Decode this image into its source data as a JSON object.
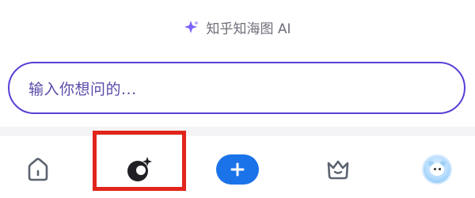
{
  "header": {
    "ai_label": "知乎知海图 AI",
    "icon": "sparkle-icon",
    "icon_color": "#7b61ff"
  },
  "search": {
    "placeholder": "输入你想问的..."
  },
  "tabbar": {
    "items": [
      {
        "name": "home",
        "icon": "home-icon"
      },
      {
        "name": "ai-night",
        "icon": "moon-sparkle-icon",
        "selected": true
      },
      {
        "name": "create",
        "icon": "plus-icon",
        "color": "#1a73e8"
      },
      {
        "name": "vip",
        "icon": "crown-icon"
      },
      {
        "name": "profile",
        "icon": "avatar"
      }
    ]
  },
  "colors": {
    "accent": "#5b3fd6",
    "highlight": "#e1251b",
    "create_button": "#1a73e8"
  }
}
